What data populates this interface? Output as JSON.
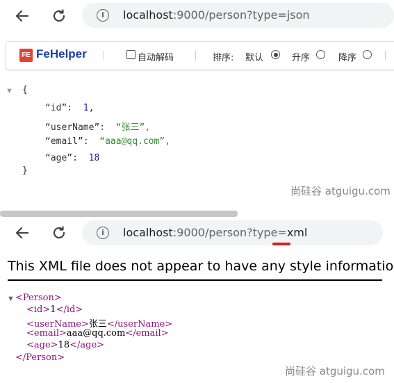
{
  "browser_top": {
    "url_host": "localhost",
    "url_rest": ":9000/person?type=json"
  },
  "fehelper": {
    "title": "FeHelper",
    "logo_text": "FE",
    "auto_decode_label": "自动解码",
    "sort_label": "排序:",
    "sort_default": "默认",
    "sort_asc": "升序",
    "sort_desc": "降序",
    "accent": "#1a3fa8"
  },
  "json_view": {
    "open_brace": "{",
    "close_brace": "}",
    "fields": [
      {
        "key": "“id”:",
        "value": "1,",
        "type": "number"
      },
      {
        "key": "“userName”:",
        "value": "“张三”,",
        "type": "string"
      },
      {
        "key": "“email”:",
        "value": "“aaa@qq.com”,",
        "type": "string"
      },
      {
        "key": "“age”:",
        "value": "18",
        "type": "number"
      }
    ]
  },
  "watermark_1": "尚硅谷 atguigu.com",
  "browser_bottom": {
    "url_host": "localhost",
    "url_rest_before": ":9000/person?type=",
    "url_highlight": "xml"
  },
  "xml_view": {
    "notice": "This XML file does not appear to have any style information",
    "lines": [
      {
        "open": "<Person>",
        "text": "",
        "close": ""
      },
      {
        "open": "<id>",
        "text": "1",
        "close": "</id>"
      },
      {
        "open": "<userName>",
        "text": "张三",
        "close": "</userName>"
      },
      {
        "open": "<email>",
        "text": "aaa@qq.com",
        "close": "</email>"
      },
      {
        "open": "<age>",
        "text": "18",
        "close": "</age>"
      },
      {
        "open": "",
        "text": "",
        "close": "</Person>"
      }
    ]
  },
  "watermark_2": "尚硅谷 atguigu.com"
}
